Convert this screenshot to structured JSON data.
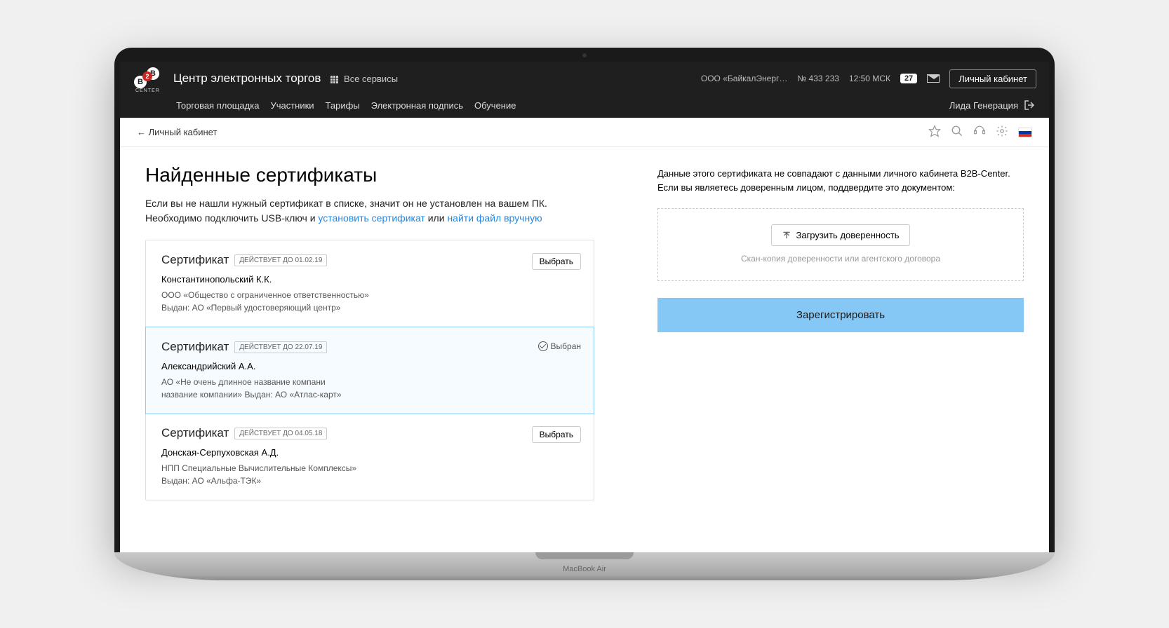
{
  "device_label": "MacBook Air",
  "header": {
    "brand_title": "Центр электронных торгов",
    "all_services": "Все сервисы",
    "logo_badge": "2",
    "logo_letter": "B",
    "logo_sub": "CENTER",
    "company": "ООО «БайкалЭнерг…",
    "number": "№ 433 233",
    "time": "12:50 МСК",
    "count": "27",
    "cabinet_btn": "Личный кабинет",
    "nav": [
      "Торговая площадка",
      "Участники",
      "Тарифы",
      "Электронная подпись",
      "Обучение"
    ],
    "user_name": "Лида Генерация"
  },
  "subbar": {
    "back": "← Личный кабинет"
  },
  "page": {
    "title": "Найденные сертификаты",
    "intro_line1": "Если вы не нашли нужный сертификат в списке, значит он не установлен на вашем ПК.",
    "intro_prefix": "Необходимо подключить USB-ключ и ",
    "intro_link1": "установить сертификат",
    "intro_mid": " или ",
    "intro_link2": "найти файл вручную"
  },
  "actions": {
    "select": "Выбрать",
    "selected": "Выбран"
  },
  "certs": [
    {
      "title": "Сертификат",
      "valid": "ДЕЙСТВУЕТ ДО 01.02.19",
      "person": "Константинопольский К.К.",
      "org": "ООО «Общество с ограниченное ответственностью»\nВыдан: АО «Первый удостоверяющий центр»",
      "selected": false
    },
    {
      "title": "Сертификат",
      "valid": "ДЕЙСТВУЕТ ДО 22.07.19",
      "person": "Александрийский А.А.",
      "org": "АО «Не очень длинное название компани\nназвание компании» Выдан:  АО «Атлас-карт»",
      "selected": true
    },
    {
      "title": "Сертификат",
      "valid": "ДЕЙСТВУЕТ ДО 04.05.18",
      "person": "Донская-Серпуховская А.Д.",
      "org": "НПП Специальные Вычислительные Комплексы»\nВыдан:  АО «Альфа-ТЭК»",
      "selected": false
    }
  ],
  "side": {
    "notice": "Данные этого сертификата не совпадают с данными личного кабинета B2B-Center. Если вы являетесь доверенным лицом, поддвердите это документом:",
    "upload_btn": "Загрузить доверенность",
    "upload_hint": "Скан-копия доверенности или агентского договора",
    "register_btn": "Зарегистрировать"
  }
}
